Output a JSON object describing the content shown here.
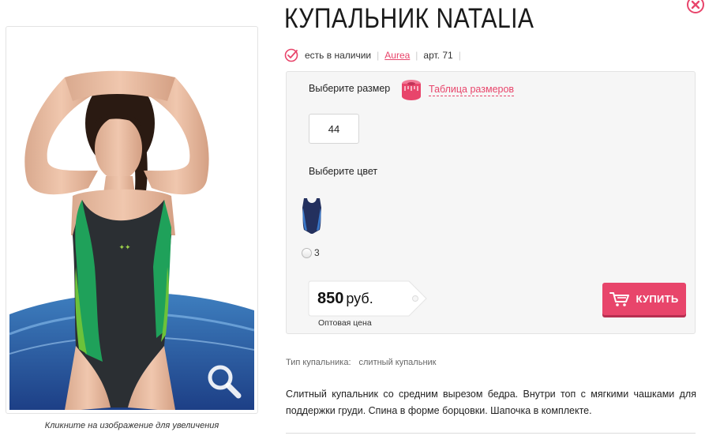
{
  "product": {
    "title": "КУПАЛЬНИК NATALIA",
    "stock": "есть в наличии",
    "brand": "Aurea",
    "article": "арт. 71"
  },
  "gallery": {
    "caption": "Кликните на изображение для увеличения"
  },
  "options": {
    "size_label": "Выберите размер",
    "size_chart_link": "Таблица размеров",
    "sizes": [
      "44"
    ],
    "color_label": "Выберите цвет",
    "color_option_value": "3"
  },
  "pricing": {
    "amount": "850",
    "currency": "руб.",
    "note": "Оптовая цена",
    "buy_label": "КУПИТЬ"
  },
  "details": {
    "type_label": "Тип купальника:",
    "type_value": "слитный купальник",
    "description": "Слитный купальник со средним вырезом бедра. Внутри топ с мягкими чашками для поддержки груди. Спина в форме борцовки. Шапочка в комплекте."
  },
  "colors": {
    "accent": "#e8456b",
    "panel_bg": "#f6f6f6",
    "swimsuit_body": "#2b2f33",
    "swimsuit_green": "#1fa15a",
    "swimsuit_lime": "#6cc23a"
  },
  "icons": [
    "close-icon",
    "check-circle-icon",
    "measuring-tape-icon",
    "magnifier-icon",
    "cart-icon"
  ]
}
